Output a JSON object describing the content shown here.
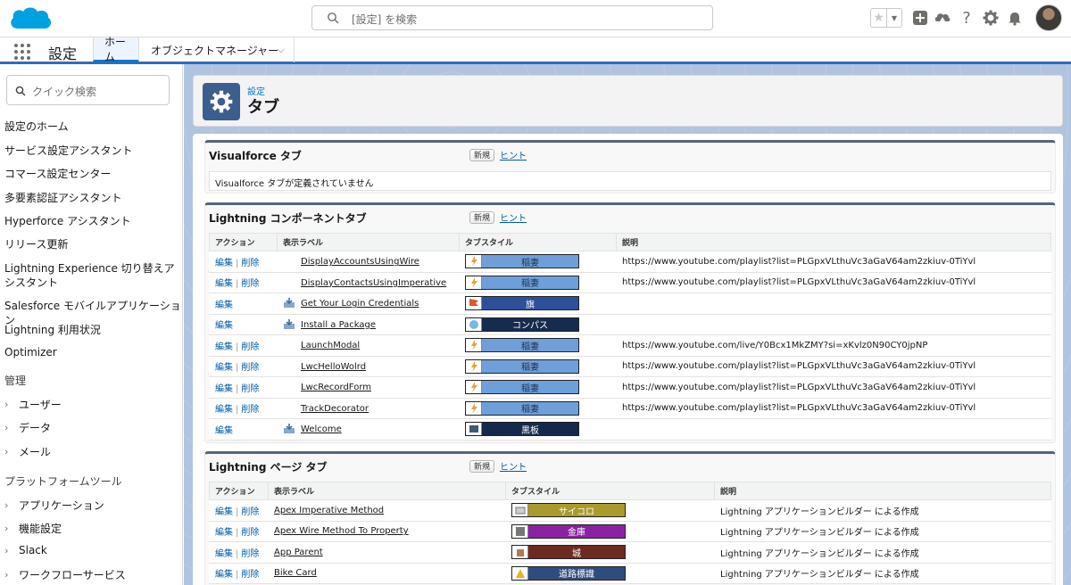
{
  "header": {
    "search_placeholder": "[設定] を検索",
    "icons": [
      "favorites-star-icon",
      "add-icon",
      "trailhead-icon",
      "help-icon",
      "setup-gear-icon",
      "notification-bell-icon"
    ]
  },
  "nav": {
    "app_name": "設定",
    "tabs": [
      {
        "label": "ホーム"
      },
      {
        "label": "オブジェクトマネージャー"
      }
    ]
  },
  "sidebar": {
    "search_placeholder": "クイック検索",
    "items": [
      "設定のホーム",
      "サービス設定アシスタント",
      "コマース設定センター",
      "多要素認証アシスタント",
      "Hyperforce アシスタント",
      "リリース更新",
      "Lightning Experience 切り替えアシスタント",
      "Salesforce モバイルアプリケーション",
      "Lightning 利用状況",
      "Optimizer"
    ],
    "section_admin": "管理",
    "admin_items": [
      "ユーザー",
      "データ",
      "メール"
    ],
    "section_platform": "プラットフォームツール",
    "platform_items": [
      "アプリケーション",
      "機能設定",
      "Slack",
      "ワークフローサービス"
    ]
  },
  "page": {
    "subtitle": "設定",
    "title": "タブ"
  },
  "common": {
    "new_button": "新規",
    "hint_link": "ヒント",
    "edit": "編集",
    "delete": "削除",
    "sep": "|"
  },
  "visualforce": {
    "title": "Visualforce タブ",
    "empty_message": "Visualforce タブが定義されていません"
  },
  "lightning_component": {
    "title": "Lightning コンポーネントタブ",
    "columns": [
      "アクション",
      "表示ラベル",
      "タブスタイル",
      "説明"
    ],
    "rows": [
      {
        "label": "DisplayAccountsUsingWire",
        "style": "稲妻",
        "desc": "https://www.youtube.com/playlist?list=PLGpxVLthuVc3aGaV64am2zkiuv-0TiYvl",
        "deletable": true,
        "package": false
      },
      {
        "label": "DisplayContactsUsingImperative",
        "style": "稲妻",
        "desc": "https://www.youtube.com/playlist?list=PLGpxVLthuVc3aGaV64am2zkiuv-0TiYvl",
        "deletable": true,
        "package": false
      },
      {
        "label": "Get Your Login Credentials",
        "style": "旗",
        "desc": "",
        "deletable": false,
        "package": true
      },
      {
        "label": "Install a Package",
        "style": "コンパス",
        "desc": "",
        "deletable": false,
        "package": true
      },
      {
        "label": "LaunchModal",
        "style": "稲妻",
        "desc": "https://www.youtube.com/live/Y0Bcx1MkZMY?si=xKvlz0N90CY0jpNP",
        "deletable": true,
        "package": false
      },
      {
        "label": "LwcHelloWolrd",
        "style": "稲妻",
        "desc": "https://www.youtube.com/playlist?list=PLGpxVLthuVc3aGaV64am2zkiuv-0TiYvl",
        "deletable": true,
        "package": false
      },
      {
        "label": "LwcRecordForm",
        "style": "稲妻",
        "desc": "https://www.youtube.com/playlist?list=PLGpxVLthuVc3aGaV64am2zkiuv-0TiYvl",
        "deletable": true,
        "package": false
      },
      {
        "label": "TrackDecorator",
        "style": "稲妻",
        "desc": "https://www.youtube.com/playlist?list=PLGpxVLthuVc3aGaV64am2zkiuv-0TiYvl",
        "deletable": true,
        "package": false
      },
      {
        "label": "Welcome",
        "style": "黒板",
        "desc": "",
        "deletable": false,
        "package": true
      }
    ]
  },
  "lightning_page": {
    "title": "Lightning ページ タブ",
    "columns": [
      "アクション",
      "表示ラベル",
      "タブスタイル",
      "説明"
    ],
    "rows": [
      {
        "label": "Apex Imperative Method",
        "style": "サイコロ",
        "desc": "Lightning アプリケーションビルダー による作成"
      },
      {
        "label": "Apex Wire Method To Property",
        "style": "金庫",
        "desc": "Lightning アプリケーションビルダー による作成"
      },
      {
        "label": "App Parent",
        "style": "城",
        "desc": "Lightning アプリケーションビルダー による作成"
      },
      {
        "label": "Bike Card",
        "style": "道路標識",
        "desc": "Lightning アプリケーションビルダー による作成"
      }
    ]
  },
  "colors": {
    "lightning_style": "#6f9fd8",
    "flag_style": "#2f4f9a",
    "compass_style": "#162b50",
    "chalkboard_style": "#14294c",
    "dice_style": "#a99a2c",
    "safe_style": "#8a23a1",
    "castle_style": "#6b2b22",
    "road_sign_style": "#2f4c7e",
    "link_blue": "#015ba7",
    "brand_blue": "#0176d3"
  }
}
